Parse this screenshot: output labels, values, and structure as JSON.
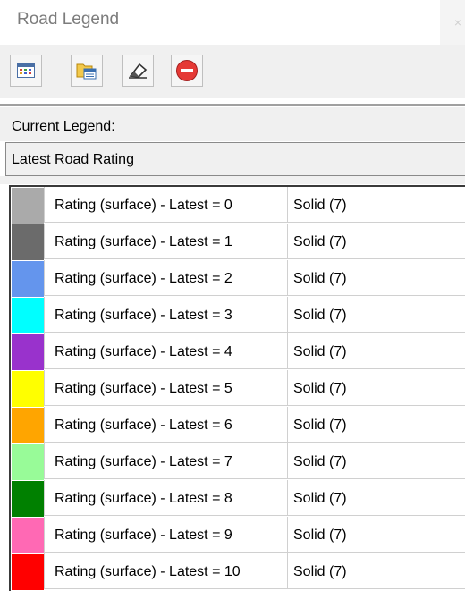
{
  "window": {
    "title": "Road Legend",
    "close_glyph": "×"
  },
  "toolbar": {
    "buttons": [
      {
        "name": "legend-grid-button",
        "icon": "grid-icon"
      },
      {
        "name": "open-folder-button",
        "icon": "folder-icon"
      },
      {
        "name": "eraser-button",
        "icon": "eraser-icon"
      },
      {
        "name": "stop-button",
        "icon": "stop-icon"
      }
    ]
  },
  "current_legend": {
    "label": "Current Legend:",
    "value": "Latest Road Rating"
  },
  "legend_rows": [
    {
      "color": "#aaaaaa",
      "name": "Rating (surface) - Latest = 0",
      "style": "Solid (7)"
    },
    {
      "color": "#6b6b6b",
      "name": "Rating (surface) - Latest = 1",
      "style": "Solid (7)"
    },
    {
      "color": "#6495ed",
      "name": "Rating (surface) - Latest = 2",
      "style": "Solid (7)"
    },
    {
      "color": "#00ffff",
      "name": "Rating (surface) - Latest = 3",
      "style": "Solid (7)"
    },
    {
      "color": "#9932cc",
      "name": "Rating (surface) - Latest = 4",
      "style": "Solid (7)"
    },
    {
      "color": "#ffff00",
      "name": "Rating (surface) - Latest = 5",
      "style": "Solid (7)"
    },
    {
      "color": "#ffa500",
      "name": "Rating (surface) - Latest = 6",
      "style": "Solid (7)"
    },
    {
      "color": "#98fb98",
      "name": "Rating (surface) - Latest = 7",
      "style": "Solid (7)"
    },
    {
      "color": "#008000",
      "name": "Rating (surface) - Latest = 8",
      "style": "Solid (7)"
    },
    {
      "color": "#ff69b4",
      "name": "Rating (surface) - Latest = 9",
      "style": "Solid (7)"
    },
    {
      "color": "#ff0000",
      "name": "Rating (surface) - Latest = 10",
      "style": "Solid (7)"
    }
  ]
}
